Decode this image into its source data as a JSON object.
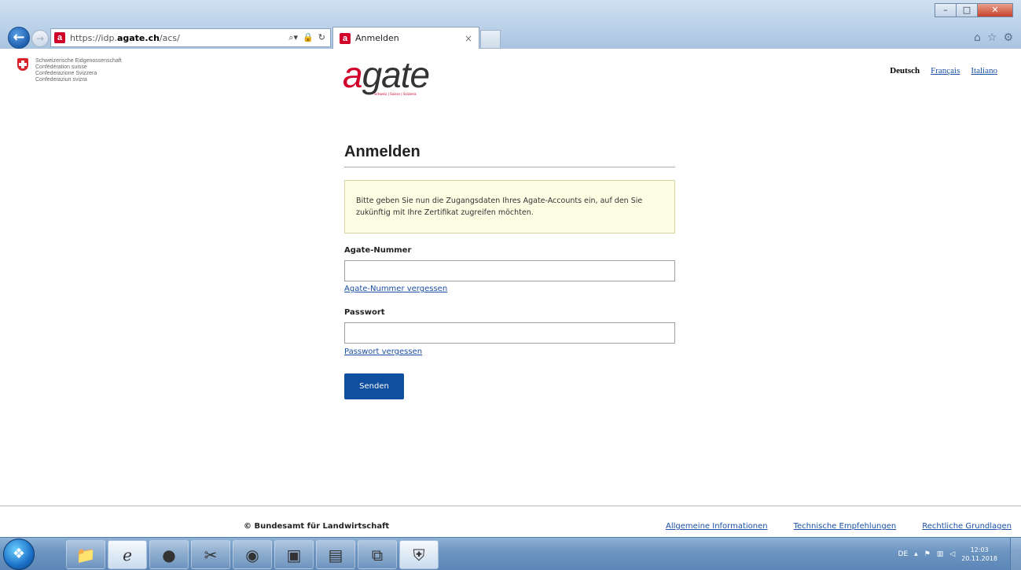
{
  "browser": {
    "url_prefix": "https://idp.",
    "url_domain": "agate.ch",
    "url_path": "/acs/",
    "tab_title": "Anmelden",
    "tab_close": "×",
    "minimize": "–",
    "maximize": "□",
    "close": "✕"
  },
  "header": {
    "confederation_lines": [
      "Schweizerische Eidgenossenschaft",
      "Confédération suisse",
      "Confederazione Svizzera",
      "Confederaziun svizra"
    ],
    "logo_text_red": "a",
    "logo_text_rest": "gate",
    "logo_tagline": "Schweiz | Suisse | Svizzera",
    "languages": {
      "active": "Deutsch",
      "french": "Français",
      "italian": "Italiano"
    }
  },
  "form": {
    "title": "Anmelden",
    "info_text": "Bitte geben Sie nun die Zugangsdaten Ihres Agate-Accounts ein, auf den Sie zukünftig mit Ihre Zertifikat zugreifen möchten.",
    "agate_number_label": "Agate-Nummer",
    "agate_number_value": "",
    "forgot_number_link": "Agate-Nummer vergessen",
    "password_label": "Passwort",
    "password_value": "",
    "forgot_password_link": "Passwort vergessen",
    "submit_label": "Senden"
  },
  "footer": {
    "copyright": "© Bundesamt für Landwirtschaft",
    "links": [
      "Allgemeine Informationen",
      "Technische Empfehlungen",
      "Rechtliche Grundlagen"
    ]
  },
  "taskbar": {
    "language": "DE",
    "time": "12:03",
    "date": "20.11.2018"
  },
  "colors": {
    "brand_red": "#d0002a",
    "button_blue": "#0f4f9f",
    "link_blue": "#1a4fa3",
    "info_bg": "#fdfde4"
  }
}
